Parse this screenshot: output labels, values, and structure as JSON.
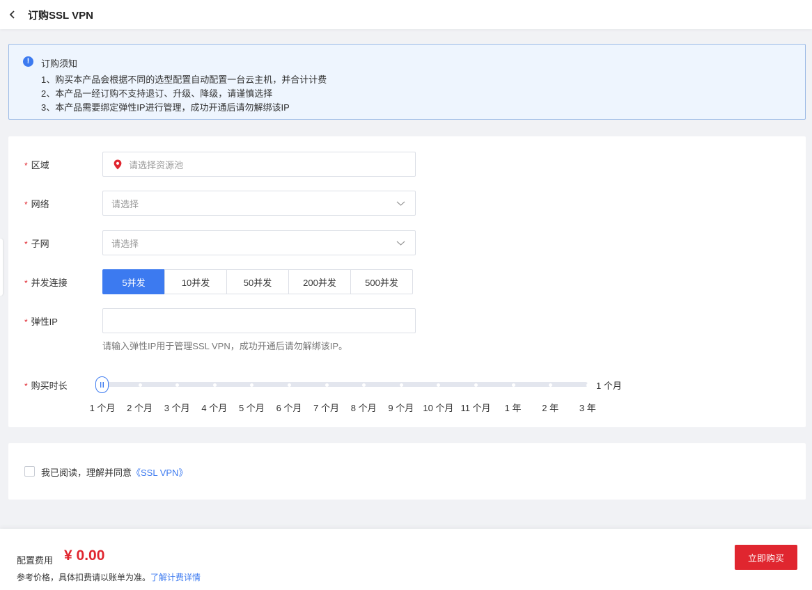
{
  "header": {
    "title": "订购SSL VPN",
    "back_icon": "chevron-left-icon"
  },
  "notice": {
    "title": "订购须知",
    "lines": [
      "1、购买本产品会根据不同的选型配置自动配置一台云主机，并合计计费",
      "2、本产品一经订购不支持退订、升级、降级，请谨慎选择",
      "3、本产品需要绑定弹性IP进行管理，成功开通后请勿解绑该IP"
    ]
  },
  "form": {
    "required_mark": "*",
    "region": {
      "label": "区域",
      "placeholder": "请选择资源池"
    },
    "network": {
      "label": "网络",
      "placeholder": "请选择"
    },
    "subnet": {
      "label": "子网",
      "placeholder": "请选择"
    },
    "concurrency": {
      "label": "并发连接",
      "options": [
        "5并发",
        "10并发",
        "50并发",
        "200并发",
        "500并发"
      ],
      "selected": "5并发"
    },
    "eip": {
      "label": "弹性IP",
      "value": "",
      "hint": "请输入弹性IP用于管理SSL VPN，成功开通后请勿解绑该IP。"
    },
    "duration": {
      "label": "购买时长",
      "value_label": "1 个月",
      "selected_index": 0,
      "ticks": [
        "1 个月",
        "2 个月",
        "3 个月",
        "4 个月",
        "5 个月",
        "6 个月",
        "7 个月",
        "8 个月",
        "9 个月",
        "10 个月",
        "11 个月",
        "1 年",
        "2 年",
        "3 年"
      ]
    }
  },
  "agreement": {
    "text": "我已阅读，理解并同意",
    "link": "《SSL VPN》",
    "checked": false
  },
  "footer": {
    "fee_label": "配置费用",
    "fee_value": "¥ 0.00",
    "ref_text": "参考价格，具体扣费请以账单为准。",
    "ref_link": "了解计费详情",
    "buy_label": "立即购买"
  },
  "colors": {
    "primary": "#3c7af0",
    "danger": "#e0262f"
  }
}
